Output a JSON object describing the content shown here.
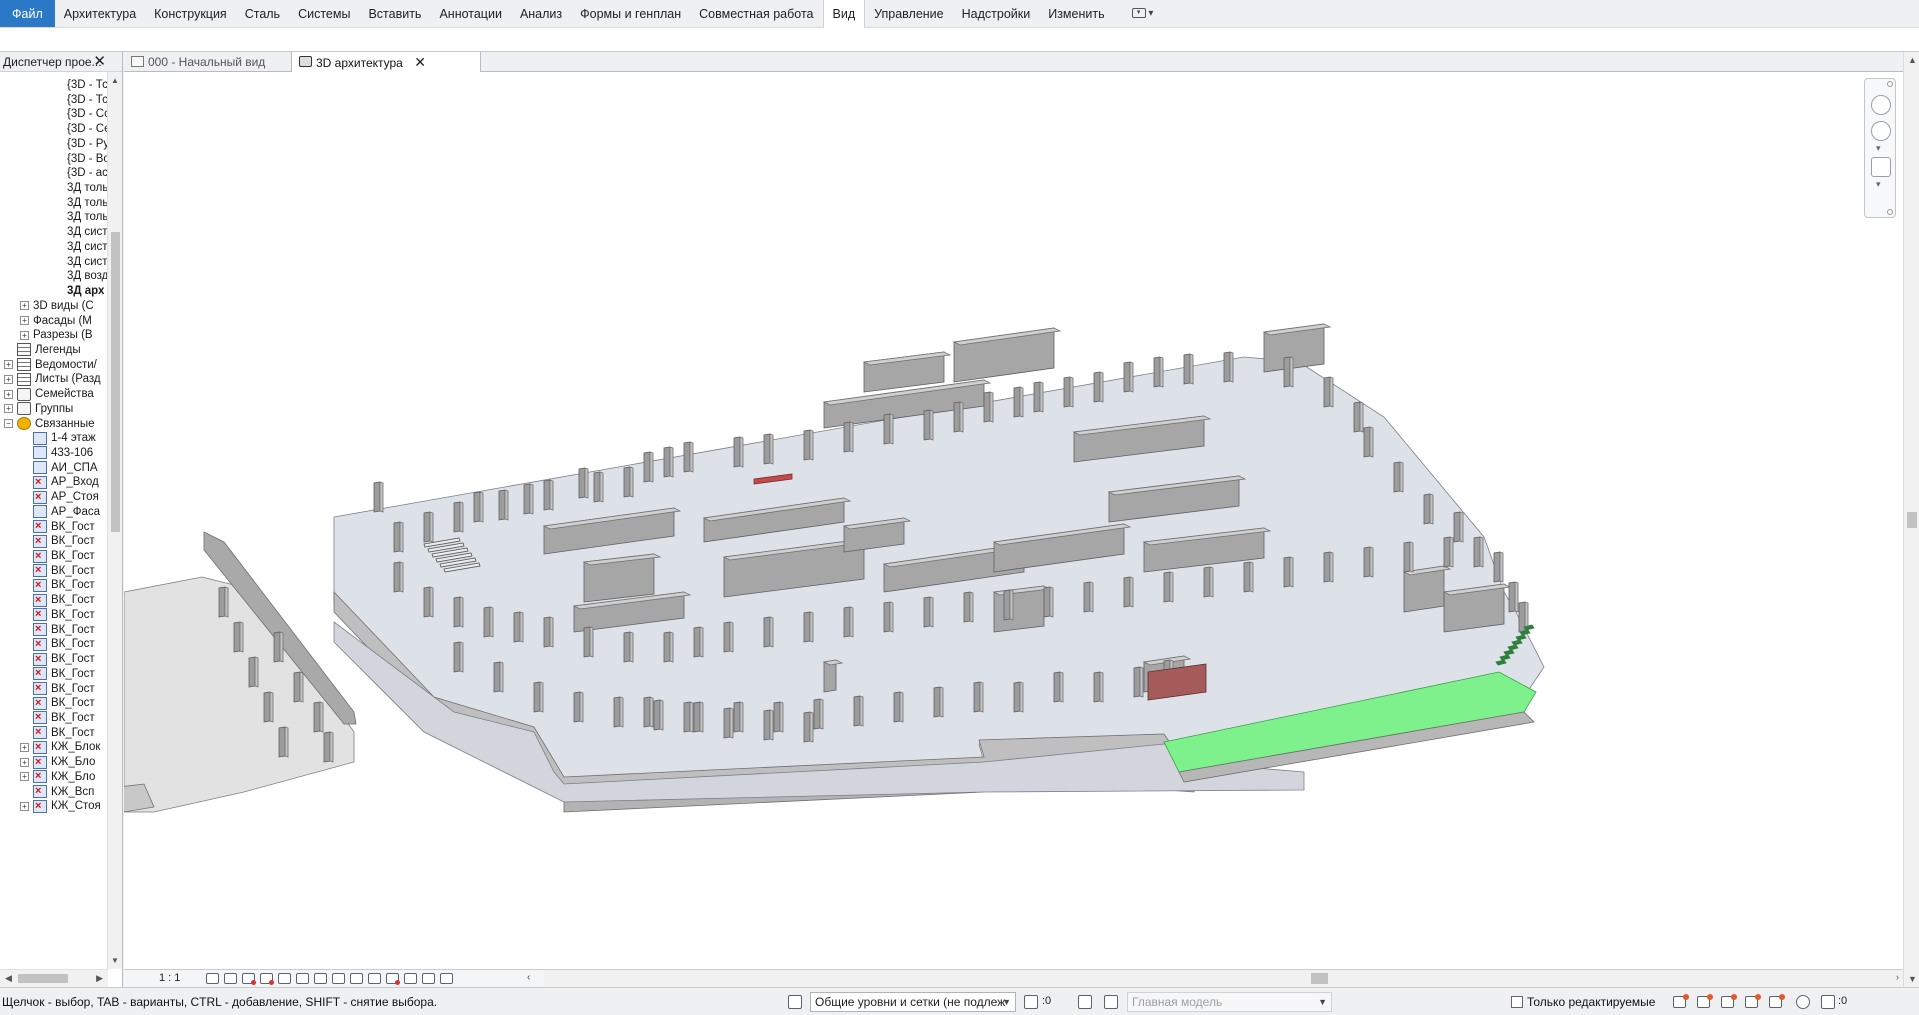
{
  "ribbon": {
    "tabs": [
      {
        "label": "Файл",
        "state": "file"
      },
      {
        "label": "Архитектура",
        "state": ""
      },
      {
        "label": "Конструкция",
        "state": ""
      },
      {
        "label": "Сталь",
        "state": ""
      },
      {
        "label": "Системы",
        "state": ""
      },
      {
        "label": "Вставить",
        "state": ""
      },
      {
        "label": "Аннотации",
        "state": ""
      },
      {
        "label": "Анализ",
        "state": ""
      },
      {
        "label": "Формы и генплан",
        "state": ""
      },
      {
        "label": "Совместная работа",
        "state": ""
      },
      {
        "label": "Вид",
        "state": "active"
      },
      {
        "label": "Управление",
        "state": ""
      },
      {
        "label": "Надстройки",
        "state": ""
      },
      {
        "label": "Изменить",
        "state": ""
      }
    ],
    "qat_icon": "dropdown-panel-icon",
    "qat_arrow": "▾"
  },
  "browser": {
    "title": "Диспетчер прое...",
    "close": "✕",
    "items": [
      {
        "label": "{3D - Тс",
        "level": 3,
        "icon": "none",
        "expander": "",
        "bold": false
      },
      {
        "label": "{3D - Тс",
        "level": 3,
        "icon": "none",
        "expander": "",
        "bold": false
      },
      {
        "label": "{3D - Сс",
        "level": 3,
        "icon": "none",
        "expander": "",
        "bold": false
      },
      {
        "label": "{3D - Се",
        "level": 3,
        "icon": "none",
        "expander": "",
        "bold": false
      },
      {
        "label": "{3D - Ру",
        "level": 3,
        "icon": "none",
        "expander": "",
        "bold": false
      },
      {
        "label": "{3D - Во",
        "level": 3,
        "icon": "none",
        "expander": "",
        "bold": false
      },
      {
        "label": "{3D - ас",
        "level": 3,
        "icon": "none",
        "expander": "",
        "bold": false
      },
      {
        "label": "3Д толь",
        "level": 3,
        "icon": "none",
        "expander": "",
        "bold": false
      },
      {
        "label": "3Д толь",
        "level": 3,
        "icon": "none",
        "expander": "",
        "bold": false
      },
      {
        "label": "3Д толь",
        "level": 3,
        "icon": "none",
        "expander": "",
        "bold": false
      },
      {
        "label": "3Д сист",
        "level": 3,
        "icon": "none",
        "expander": "",
        "bold": false
      },
      {
        "label": "3Д сист",
        "level": 3,
        "icon": "none",
        "expander": "",
        "bold": false
      },
      {
        "label": "3Д сист",
        "level": 3,
        "icon": "none",
        "expander": "",
        "bold": false
      },
      {
        "label": "3Д возд",
        "level": 3,
        "icon": "none",
        "expander": "",
        "bold": false
      },
      {
        "label": "3Д арх",
        "level": 3,
        "icon": "none",
        "expander": "",
        "bold": true
      },
      {
        "label": "3D виды (С",
        "level": 2,
        "icon": "none",
        "expander": "+",
        "bold": false
      },
      {
        "label": "Фасады (М",
        "level": 2,
        "icon": "none",
        "expander": "+",
        "bold": false
      },
      {
        "label": "Разрезы (В",
        "level": 2,
        "icon": "none",
        "expander": "+",
        "bold": false
      },
      {
        "label": "Легенды",
        "level": 1,
        "icon": "sheet",
        "expander": "",
        "bold": false
      },
      {
        "label": "Ведомости/",
        "level": 1,
        "icon": "sheet",
        "expander": "+",
        "bold": false
      },
      {
        "label": "Листы (Разд",
        "level": 1,
        "icon": "sheet",
        "expander": "+",
        "bold": false
      },
      {
        "label": "Семейства",
        "level": 1,
        "icon": "grp",
        "expander": "+",
        "bold": false
      },
      {
        "label": "Группы",
        "level": 1,
        "icon": "grp",
        "expander": "+",
        "bold": false
      },
      {
        "label": "Связанные",
        "level": 1,
        "icon": "links",
        "expander": "−",
        "bold": false
      },
      {
        "label": "1-4 этаж",
        "level": 2,
        "icon": "link",
        "expander": "",
        "bold": false
      },
      {
        "label": "433-106",
        "level": 2,
        "icon": "link",
        "expander": "",
        "bold": false
      },
      {
        "label": "АИ_СПА",
        "level": 2,
        "icon": "link",
        "expander": "",
        "bold": false
      },
      {
        "label": "АР_Вход",
        "level": 2,
        "icon": "link-err",
        "expander": "",
        "bold": false
      },
      {
        "label": "АР_Стоя",
        "level": 2,
        "icon": "link-err",
        "expander": "",
        "bold": false
      },
      {
        "label": "АР_Фаса",
        "level": 2,
        "icon": "link",
        "expander": "",
        "bold": false
      },
      {
        "label": "ВК_Гост",
        "level": 2,
        "icon": "link-err",
        "expander": "",
        "bold": false
      },
      {
        "label": "ВК_Гост",
        "level": 2,
        "icon": "link-err",
        "expander": "",
        "bold": false
      },
      {
        "label": "ВК_Гост",
        "level": 2,
        "icon": "link-err",
        "expander": "",
        "bold": false
      },
      {
        "label": "ВК_Гост",
        "level": 2,
        "icon": "link-err",
        "expander": "",
        "bold": false
      },
      {
        "label": "ВК_Гост",
        "level": 2,
        "icon": "link-err",
        "expander": "",
        "bold": false
      },
      {
        "label": "ВК_Гост",
        "level": 2,
        "icon": "link-err",
        "expander": "",
        "bold": false
      },
      {
        "label": "ВК_Гост",
        "level": 2,
        "icon": "link-err",
        "expander": "",
        "bold": false
      },
      {
        "label": "ВК_Гост",
        "level": 2,
        "icon": "link-err",
        "expander": "",
        "bold": false
      },
      {
        "label": "ВК_Гост",
        "level": 2,
        "icon": "link-err",
        "expander": "",
        "bold": false
      },
      {
        "label": "ВК_Гост",
        "level": 2,
        "icon": "link-err",
        "expander": "",
        "bold": false
      },
      {
        "label": "ВК_Гост",
        "level": 2,
        "icon": "link-err",
        "expander": "",
        "bold": false
      },
      {
        "label": "ВК_Гост",
        "level": 2,
        "icon": "link-err",
        "expander": "",
        "bold": false
      },
      {
        "label": "ВК_Гост",
        "level": 2,
        "icon": "link-err",
        "expander": "",
        "bold": false
      },
      {
        "label": "ВК_Гост",
        "level": 2,
        "icon": "link-err",
        "expander": "",
        "bold": false
      },
      {
        "label": "ВК_Гост",
        "level": 2,
        "icon": "link-err",
        "expander": "",
        "bold": false
      },
      {
        "label": "КЖ_Блок",
        "level": 2,
        "icon": "link-err",
        "expander": "+",
        "bold": false
      },
      {
        "label": "КЖ_Бло",
        "level": 2,
        "icon": "link-err",
        "expander": "+",
        "bold": false
      },
      {
        "label": "КЖ_Бло",
        "level": 2,
        "icon": "link-err",
        "expander": "+",
        "bold": false
      },
      {
        "label": "КЖ_Всп",
        "level": 2,
        "icon": "link-err",
        "expander": "",
        "bold": false
      },
      {
        "label": "КЖ_Стоя",
        "level": 2,
        "icon": "link-err",
        "expander": "+",
        "bold": false
      }
    ]
  },
  "view_tabs": [
    {
      "label": "000 - Начальный вид",
      "active": false,
      "closable": false
    },
    {
      "label": "3D архитектура",
      "active": true,
      "closable": true
    }
  ],
  "view_tabs_close": "✕",
  "view_tabs_menu": "▾",
  "view_bar": {
    "scale": "1 : 1",
    "left_arrow": "‹",
    "right_arrow": "›"
  },
  "status": {
    "hint": "Щелчок - выбор, TAB - варианты, CTRL - добавление, SHIFT - снятие выбора.",
    "workset": "Общие уровни и сетки (не подлеж",
    "workset_count": ":0",
    "design_option": "Главная модель",
    "editable_only": "Только редактируемые",
    "filter_count": ":0"
  },
  "colors": {
    "file_tab": "#2b78c6",
    "slab_top": "#dde1e8",
    "wall_face": "#a6a6a6",
    "wall_top": "#cfcfcf",
    "green_ramp": "#7ef08c",
    "red_element": "#a65b5b"
  }
}
